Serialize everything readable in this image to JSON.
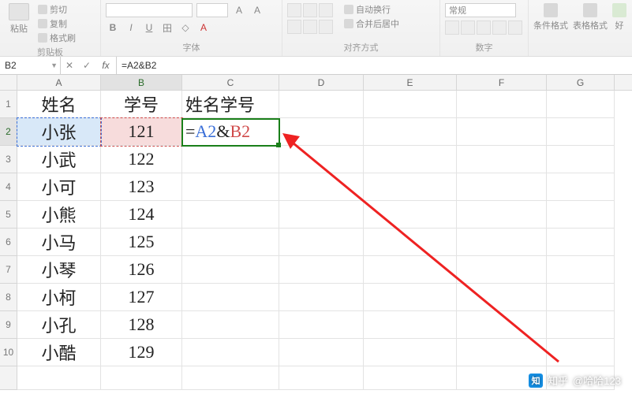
{
  "ribbon": {
    "clipboard": {
      "label": "剪贴板",
      "paste": "粘贴",
      "cut": "剪切",
      "copy": "复制",
      "format": "格式刷"
    },
    "font": {
      "label": "字体",
      "bold": "B",
      "italic": "I",
      "underline": "U"
    },
    "alignment": {
      "label": "对齐方式",
      "wrap": "自动换行",
      "merge": "合并后居中"
    },
    "number": {
      "label": "数字",
      "general": "常规"
    },
    "styles": {
      "cond": "条件格式",
      "table": "表格格式",
      "cell": "好"
    }
  },
  "namebox": "B2",
  "formula_bar": "=A2&B2",
  "fx": {
    "cancel": "✕",
    "confirm": "✓",
    "fx": "fx"
  },
  "columns": [
    "A",
    "B",
    "C",
    "D",
    "E",
    "F",
    "G"
  ],
  "headers": {
    "A": "姓名",
    "B": "学号",
    "C": "姓名学号"
  },
  "active_formula": {
    "eq": "=",
    "ref1": "A2",
    "amp": "&",
    "ref2": "B2"
  },
  "rows": [
    {
      "n": "1"
    },
    {
      "n": "2",
      "A": "小张",
      "B": "121"
    },
    {
      "n": "3",
      "A": "小武",
      "B": "122"
    },
    {
      "n": "4",
      "A": "小可",
      "B": "123"
    },
    {
      "n": "5",
      "A": "小熊",
      "B": "124"
    },
    {
      "n": "6",
      "A": "小马",
      "B": "125"
    },
    {
      "n": "7",
      "A": "小琴",
      "B": "126"
    },
    {
      "n": "8",
      "A": "小柯",
      "B": "127"
    },
    {
      "n": "9",
      "A": "小孔",
      "B": "128"
    },
    {
      "n": "10",
      "A": "小酷",
      "B": "129"
    }
  ],
  "watermark": {
    "logo": "知",
    "site": "知乎",
    "user": "@哈哈123"
  }
}
